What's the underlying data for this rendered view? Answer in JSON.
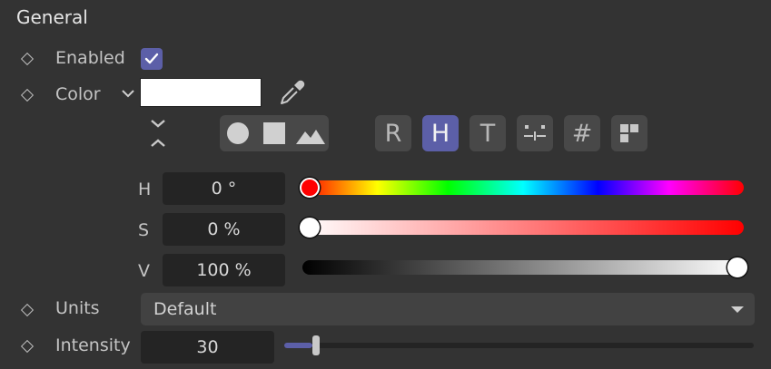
{
  "section": {
    "title": "General"
  },
  "enabled": {
    "label": "Enabled",
    "checked": true
  },
  "color": {
    "label": "Color",
    "swatch_hex": "#ffffff",
    "modes": [
      "R",
      "H",
      "T"
    ],
    "active_mode": "H",
    "hex_mode_label": "#"
  },
  "hsv": {
    "h_label": "H",
    "h_value": "0 °",
    "h_fraction": 0,
    "s_label": "S",
    "s_value": "0 %",
    "s_fraction": 0,
    "v_label": "V",
    "v_value": "100 %",
    "v_fraction": 1
  },
  "units": {
    "label": "Units",
    "value": "Default"
  },
  "intensity": {
    "label": "Intensity",
    "value": "30",
    "slider_fraction": 0.06
  },
  "colors": {
    "accent": "#5c5fa8",
    "background": "#333333",
    "field": "#242424"
  }
}
